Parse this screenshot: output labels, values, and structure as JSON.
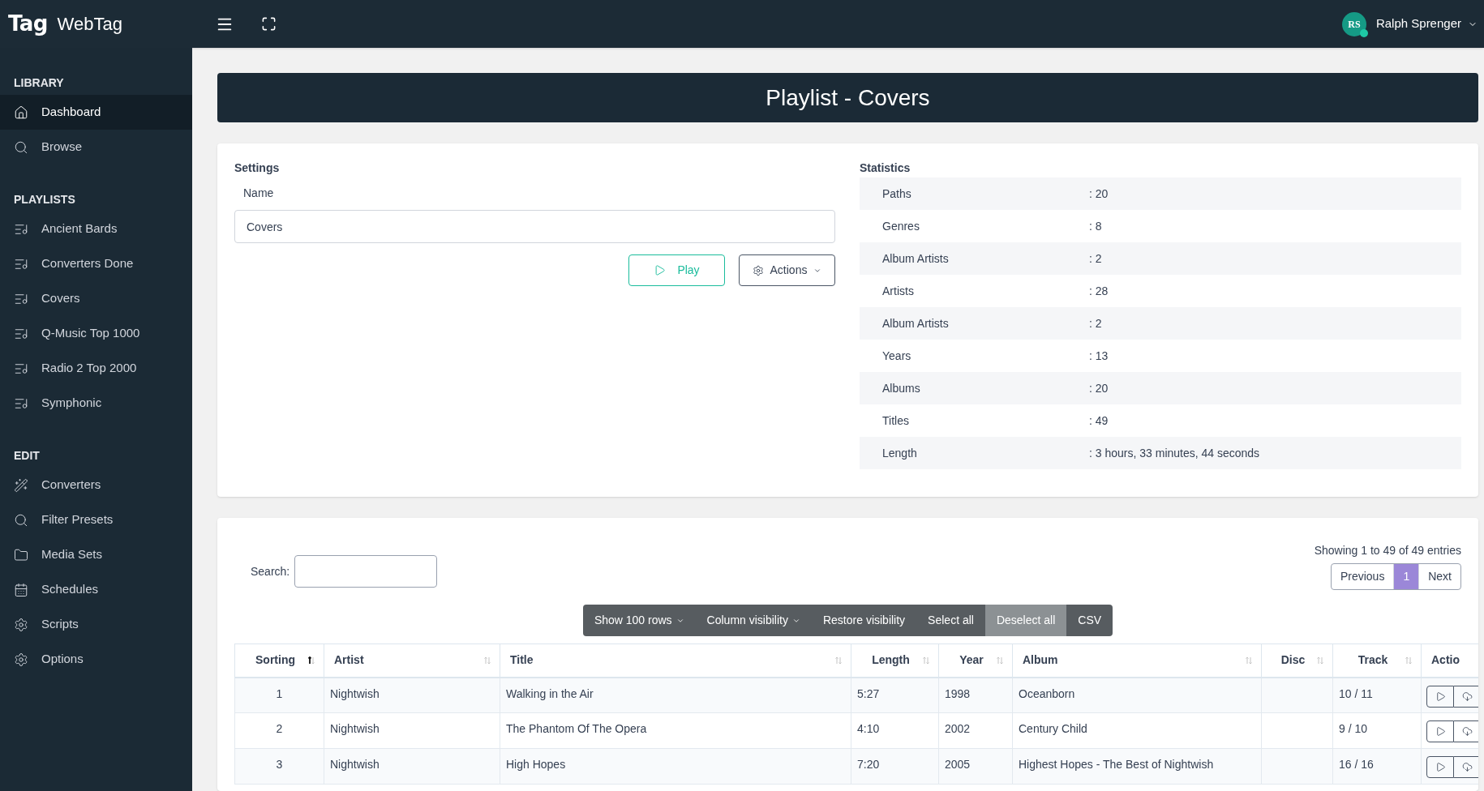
{
  "brand": {
    "logo": "Tag",
    "name": "WebTag"
  },
  "user": {
    "initials": "RS",
    "name": "Ralph Sprenger",
    "online": true
  },
  "sidebar": {
    "sections": [
      {
        "title": "LIBRARY",
        "items": [
          {
            "label": "Dashboard",
            "kind": "home",
            "selected": true
          },
          {
            "label": "Browse",
            "kind": "search",
            "selected": false
          }
        ]
      },
      {
        "title": "PLAYLISTS",
        "items": [
          {
            "label": "Ancient Bards",
            "kind": "playlist",
            "selected": false
          },
          {
            "label": "Converters Done",
            "kind": "playlist",
            "selected": false
          },
          {
            "label": "Covers",
            "kind": "playlist",
            "selected": false
          },
          {
            "label": "Q-Music Top 1000",
            "kind": "playlist",
            "selected": false
          },
          {
            "label": "Radio 2 Top 2000",
            "kind": "playlist",
            "selected": false
          },
          {
            "label": "Symphonic",
            "kind": "playlist",
            "selected": false
          }
        ]
      },
      {
        "title": "EDIT",
        "items": [
          {
            "label": "Converters",
            "kind": "wand",
            "selected": false
          },
          {
            "label": "Filter Presets",
            "kind": "search",
            "selected": false
          },
          {
            "label": "Media Sets",
            "kind": "folder",
            "selected": false
          },
          {
            "label": "Schedules",
            "kind": "calendar",
            "selected": false
          },
          {
            "label": "Scripts",
            "kind": "gear",
            "selected": false
          },
          {
            "label": "Options",
            "kind": "gear",
            "selected": false
          }
        ]
      }
    ]
  },
  "page_title": "Playlist - Covers",
  "settings": {
    "title": "Settings",
    "name_label": "Name",
    "name_value": "Covers",
    "play_button": "Play",
    "actions_button": "Actions"
  },
  "statistics": {
    "title": "Statistics",
    "rows": [
      {
        "label": "Paths",
        "value": ": 20"
      },
      {
        "label": "Genres",
        "value": ": 8"
      },
      {
        "label": "Album Artists",
        "value": ": 2"
      },
      {
        "label": "Artists",
        "value": ": 28"
      },
      {
        "label": "Album Artists",
        "value": ": 2"
      },
      {
        "label": "Years",
        "value": ": 13"
      },
      {
        "label": "Albums",
        "value": ": 20"
      },
      {
        "label": "Titles",
        "value": ": 49"
      },
      {
        "label": "Length",
        "value": ": 3 hours, 33 minutes, 44 seconds"
      }
    ]
  },
  "table": {
    "search_label": "Search:",
    "info": "Showing 1 to 49 of 49 entries",
    "pagination": [
      {
        "label": "Previous",
        "selected": false
      },
      {
        "label": "1",
        "selected": true
      },
      {
        "label": "Next",
        "selected": false
      }
    ],
    "toolbar": [
      {
        "label": "Show 100 rows",
        "kind": "dropdown",
        "selected": false
      },
      {
        "label": "Column visibility",
        "kind": "dropdown",
        "selected": false
      },
      {
        "label": "Restore visibility",
        "kind": "button",
        "selected": false
      },
      {
        "label": "Select all",
        "kind": "button",
        "selected": false
      },
      {
        "label": "Deselect all",
        "kind": "button",
        "selected": true
      },
      {
        "label": "CSV",
        "kind": "button",
        "selected": false
      }
    ],
    "columns": [
      {
        "label": "Sorting",
        "sorted": true
      },
      {
        "label": "Artist",
        "sorted": false
      },
      {
        "label": "Title",
        "sorted": false
      },
      {
        "label": "Length",
        "sorted": false
      },
      {
        "label": "Year",
        "sorted": false
      },
      {
        "label": "Album",
        "sorted": false
      },
      {
        "label": "Disc",
        "sorted": false
      },
      {
        "label": "Track",
        "sorted": false
      },
      {
        "label": "Actio"
      }
    ],
    "rows": [
      {
        "cells": [
          "1",
          "Nightwish",
          "Walking in the Air",
          "5:27",
          "1998",
          "Oceanborn",
          "",
          "10 / 11"
        ]
      },
      {
        "cells": [
          "2",
          "Nightwish",
          "The Phantom Of The Opera",
          "4:10",
          "2002",
          "Century Child",
          "",
          "9 / 10"
        ]
      },
      {
        "cells": [
          "3",
          "Nightwish",
          "High Hopes",
          "7:20",
          "2005",
          "Highest Hopes - The Best of Nightwish",
          "",
          "16 / 16"
        ]
      }
    ]
  }
}
